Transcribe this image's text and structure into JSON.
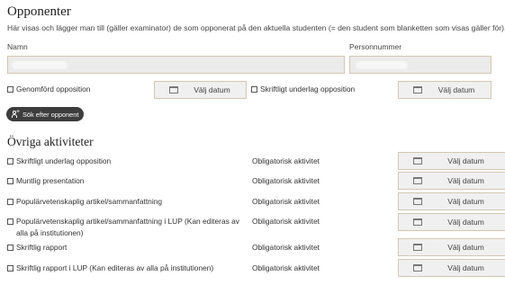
{
  "opponents": {
    "title": "Opponenter",
    "description": "Här visas och lägger man till (gäller examinator) de som opponerat på den aktuella studenten (= den student som blanketten som visas gäller för).",
    "name_label": "Namn",
    "pnr_label": "Personnummer",
    "completed_opposition_label": "Genomförd opposition",
    "written_basis_label": "Skriftligt underlag opposition",
    "choose_date": "Välj datum",
    "search_button": "Sök efter opponent"
  },
  "activities": {
    "title": "Övriga aktiviteter",
    "choose_date": "Välj datum",
    "items": [
      {
        "label": "Skriftligt underlag opposition",
        "status": "Obligatorisk aktivitet"
      },
      {
        "label": "Muntlig presentation",
        "status": "Obligatorisk aktivitet"
      },
      {
        "label": "Populärvetenskaplig artikel/sammanfattning",
        "status": "Obligatorisk aktivitet"
      },
      {
        "label": "Populärvetenskaplig artikel/sammanfattning i LUP (Kan editeras av alla på institutionen)",
        "status": "Obligatorisk aktivitet"
      },
      {
        "label": "Skriftlig rapport",
        "status": "Obligatorisk aktivitet"
      },
      {
        "label": "Skriftlig rapport i LUP (Kan editeras av alla på institutionen)",
        "status": "Obligatorisk aktivitet"
      }
    ]
  }
}
